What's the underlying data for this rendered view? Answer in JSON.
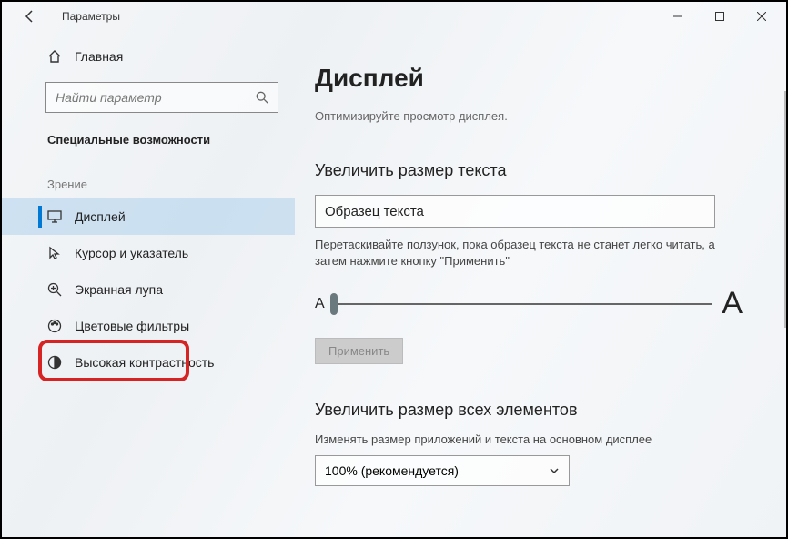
{
  "titlebar": {
    "app_title": "Параметры"
  },
  "sidebar": {
    "home_label": "Главная",
    "search_placeholder": "Найти параметр",
    "section_title": "Специальные возможности",
    "group_label": "Зрение",
    "items": [
      {
        "label": "Дисплей"
      },
      {
        "label": "Курсор и указатель"
      },
      {
        "label": "Экранная лупа"
      },
      {
        "label": "Цветовые фильтры"
      },
      {
        "label": "Высокая контрастность"
      }
    ]
  },
  "main": {
    "title": "Дисплей",
    "subtitle": "Оптимизируйте просмотр дисплея.",
    "section1_title": "Увеличить размер текста",
    "sample_text": "Образец текста",
    "slider_hint": "Перетаскивайте ползунок, пока образец текста не станет легко читать, а затем нажмите кнопку \"Применить\"",
    "small_a": "A",
    "big_a": "A",
    "apply_label": "Применить",
    "section2_title": "Увеличить размер всех элементов",
    "scale_desc": "Изменять размер приложений и текста на основном дисплее",
    "scale_value": "100% (рекомендуется)"
  }
}
